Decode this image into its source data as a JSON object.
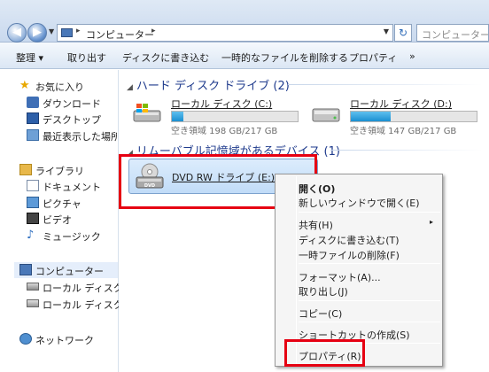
{
  "address": {
    "crumb": "コンピューター",
    "sep": "▸",
    "search_placeholder": "コンピューター..."
  },
  "toolbar": {
    "organize": "整理 ▾",
    "eject": "取り出す",
    "burn": "ディスクに書き込む",
    "delete_temp": "一時的なファイルを削除する",
    "properties": "プロパティ",
    "more": "»"
  },
  "nav": {
    "favorites": "お気に入り",
    "downloads": "ダウンロード",
    "desktop": "デスクトップ",
    "recent": "最近表示した場所",
    "libraries": "ライブラリ",
    "documents": "ドキュメント",
    "pictures": "ピクチャ",
    "videos": "ビデオ",
    "music": "ミュージック",
    "computer": "コンピューター",
    "local_c": "ローカル ディスク (",
    "local_d": "ローカル ディスク (",
    "network": "ネットワーク"
  },
  "content": {
    "hdd_group": "ハード ディスク ドライブ (2)",
    "removable_group": "リムーバブル記憶域があるデバイス (1)",
    "drives": [
      {
        "name": "ローカル ディスク (C:)",
        "free": "空き領域 198 GB/217 GB",
        "used_fraction": 0.09
      },
      {
        "name": "ローカル ディスク (D:)",
        "free": "空き領域 147 GB/217 GB",
        "used_fraction": 0.32
      }
    ],
    "dvd": {
      "name": "DVD RW ドライブ (E:)",
      "label": "DVD"
    }
  },
  "context_menu": {
    "open": "開く(O)",
    "open_new_window": "新しいウィンドウで開く(E)",
    "share": "共有(H)",
    "burn": "ディスクに書き込む(T)",
    "delete_temp": "一時ファイルの削除(F)",
    "format": "フォーマット(A)...",
    "eject": "取り出し(J)",
    "copy": "コピー(C)",
    "create_shortcut": "ショートカットの作成(S)",
    "properties": "プロパティ(R)",
    "submenu_arrow": "▸"
  },
  "colors": {
    "highlight_box": "#e60012",
    "drive_bar": "#1b8fd1",
    "group_header": "#1e3a8c"
  }
}
